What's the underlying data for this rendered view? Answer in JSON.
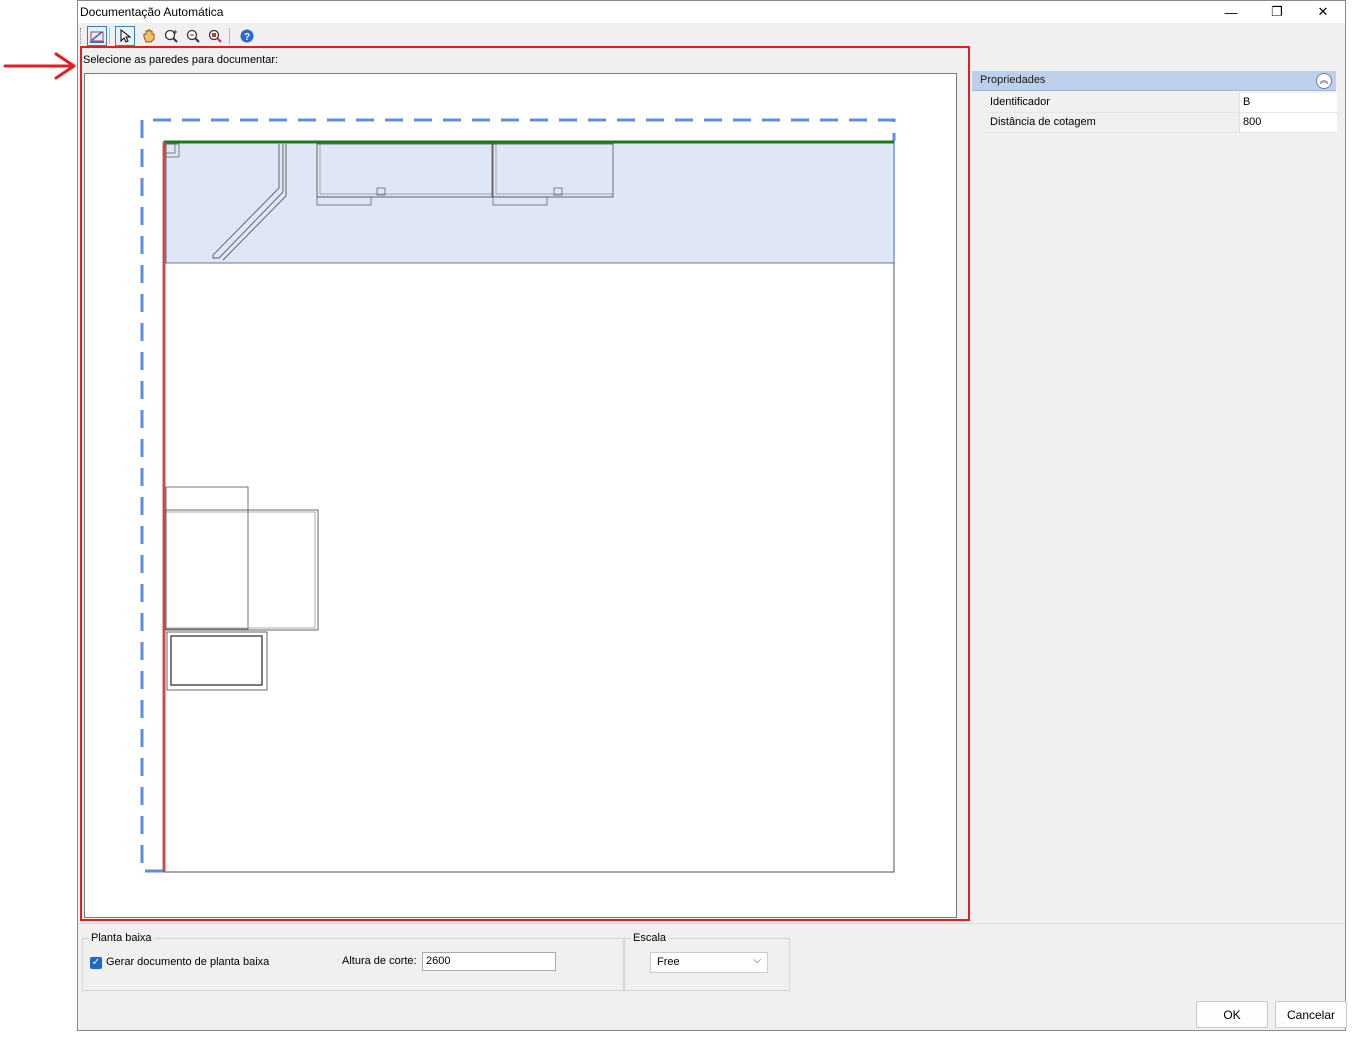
{
  "window": {
    "title": "Documentação Automática",
    "controls": {
      "minimize": "—",
      "restore": "❐",
      "close": "✕"
    }
  },
  "toolbar": {
    "tools": [
      {
        "name": "select-walls-icon",
        "active": true
      },
      {
        "name": "pointer-icon",
        "active": true
      },
      {
        "name": "pan-hand-icon",
        "active": false
      },
      {
        "name": "zoom-in-out-icon",
        "active": false
      },
      {
        "name": "zoom-window-icon",
        "active": false
      },
      {
        "name": "zoom-extents-icon",
        "active": false
      },
      {
        "name": "help-icon",
        "active": false
      }
    ]
  },
  "main": {
    "selection_label": "Selecione as paredes para documentar:"
  },
  "properties": {
    "title": "Propriedades",
    "rows": [
      {
        "name": "Identificador",
        "value": "B"
      },
      {
        "name": "Distância de cotagem",
        "value": "800"
      }
    ]
  },
  "bottom": {
    "planta_group_title": "Planta baixa",
    "generate_checkbox_label": "Gerar documento de planta baixa",
    "generate_checked": true,
    "altura_label": "Altura de corte:",
    "altura_value": "2600",
    "escala_group_title": "Escala",
    "escala_value": "Free"
  },
  "buttons": {
    "ok": "OK",
    "cancel": "Cancelar"
  },
  "colors": {
    "highlight_border": "#e02020",
    "selected_wall_green": "#1a7a1a",
    "wall_red": "#c0504d",
    "dashed_selection": "#5b8fe0",
    "room_fill": "#dfe7f7",
    "props_header": "#bcd0eb",
    "annotation_arrow": "#e02020"
  }
}
